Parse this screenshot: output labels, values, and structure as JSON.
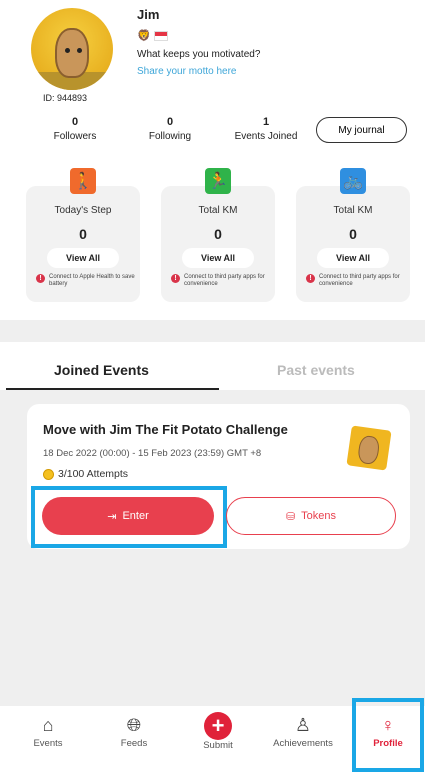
{
  "profile": {
    "name": "Jim",
    "id": "ID: 944893",
    "motto_question": "What keeps you motivated?",
    "motto_link": "Share your motto here",
    "badge_emoji": "🦁"
  },
  "stats": [
    {
      "value": "0",
      "label": "Followers"
    },
    {
      "value": "0",
      "label": "Following"
    },
    {
      "value": "1",
      "label": "Events Joined"
    }
  ],
  "journal_button": "My journal",
  "cards": [
    {
      "title": "Today's Step",
      "value": "0",
      "button": "View All",
      "note": "Connect to Apple Health to save battery",
      "icon": "walking-icon",
      "color": "#f06a2c",
      "glyph": "🚶"
    },
    {
      "title": "Total KM",
      "value": "0",
      "button": "View All",
      "note": "Connect to third party apps for convenience",
      "icon": "running-icon",
      "color": "#2fb34a",
      "glyph": "🏃"
    },
    {
      "title": "Total KM",
      "value": "0",
      "button": "View All",
      "note": "Connect to third party apps for convenience",
      "icon": "cycling-icon",
      "color": "#2f8fe0",
      "glyph": "🚲"
    }
  ],
  "tabs": {
    "joined": "Joined Events",
    "past": "Past events"
  },
  "event": {
    "title": "Move with Jim The Fit Potato Challenge",
    "dates": "18 Dec 2022 (00:00) - 15 Feb 2023 (23:59) GMT +8",
    "attempts": "3/100 Attempts",
    "enter_label": "Enter",
    "tokens_label": "Tokens"
  },
  "nav": [
    {
      "label": "Events",
      "icon": "house-icon"
    },
    {
      "label": "Feeds",
      "icon": "globe-icon"
    },
    {
      "label": "Submit",
      "icon": "plus-icon"
    },
    {
      "label": "Achievements",
      "icon": "medal-icon"
    },
    {
      "label": "Profile",
      "icon": "person-icon"
    }
  ],
  "colors": {
    "accent": "#e8404e",
    "highlight": "#1aa7e6",
    "link": "#3ea6d8"
  }
}
